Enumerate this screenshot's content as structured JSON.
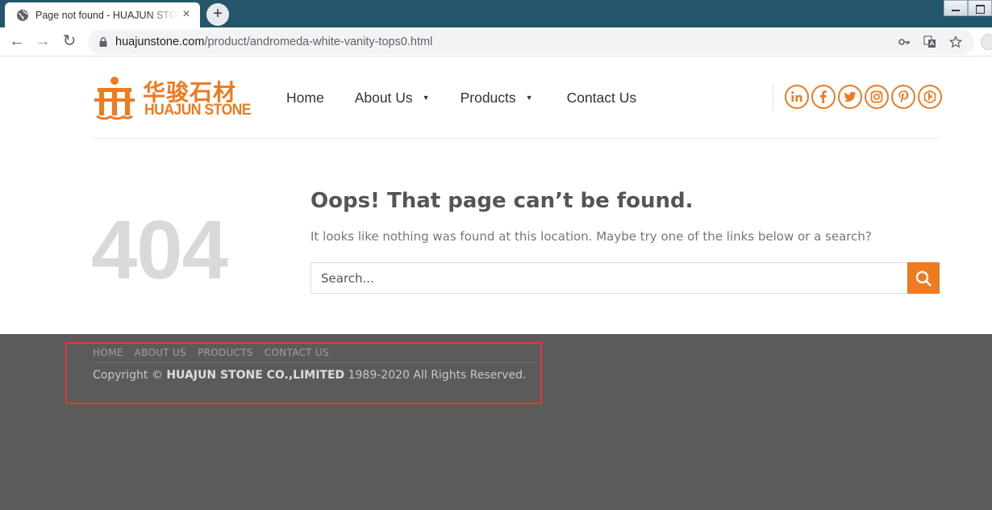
{
  "browser": {
    "tab_title": "Page not found - HUAJUN STONE",
    "tab_close": "×",
    "new_tab": "+",
    "url_host": "huajunstone.com",
    "url_path": "/product/andromeda-white-vanity-tops0.html",
    "nav": {
      "back": "←",
      "forward": "→",
      "reload": "↻"
    }
  },
  "logo": {
    "cn": "华骏石材",
    "en": "HUAJUN STONE"
  },
  "nav": {
    "items": [
      {
        "label": "Home",
        "dropdown": false
      },
      {
        "label": "About Us",
        "dropdown": true
      },
      {
        "label": "Products",
        "dropdown": true
      },
      {
        "label": "Contact Us",
        "dropdown": false
      }
    ],
    "caret": "▼"
  },
  "social": [
    "linkedin-icon",
    "facebook-icon",
    "twitter-icon",
    "instagram-icon",
    "pinterest-icon",
    "houzz-icon"
  ],
  "error": {
    "code": "404",
    "heading": "Oops! That page can’t be found.",
    "message": "It looks like nothing was found at this location. Maybe try one of the links below or a search?",
    "search_placeholder": "Search..."
  },
  "footer": {
    "links": [
      "HOME",
      "ABOUT US",
      "PRODUCTS",
      "CONTACT US"
    ],
    "copyright_prefix": "Copyright © ",
    "company": "HUAJUN STONE CO.,LIMITED",
    "copyright_suffix": " 1989-2020 All Rights Reserved."
  },
  "colors": {
    "accent": "#f07a1f",
    "footer_bg": "#5b5b5b",
    "tabbar_bg": "#23566a",
    "annotation": "#e0393a"
  }
}
